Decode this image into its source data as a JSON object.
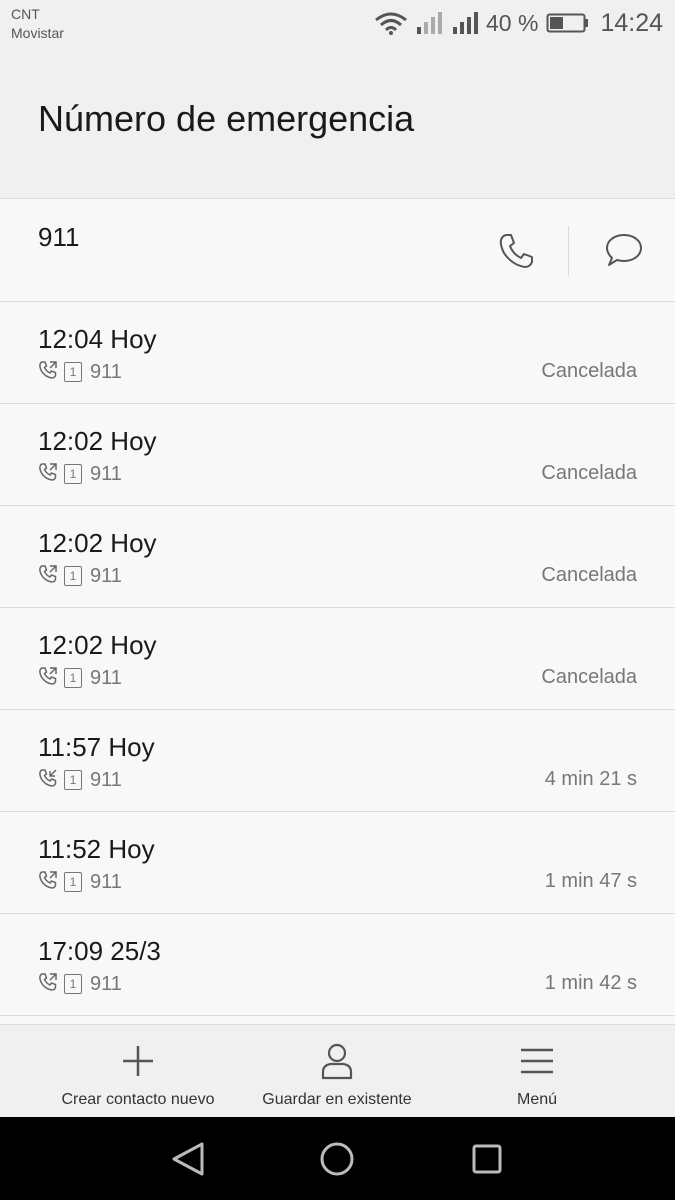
{
  "status_bar": {
    "carrier_line1": "CNT",
    "carrier_line2": "Movistar",
    "battery_percent": "40 %",
    "battery_level": 0.4,
    "time": "14:24"
  },
  "header": {
    "title": "Número de emergencia"
  },
  "number_row": {
    "number": "911",
    "call_icon": "phone-icon",
    "message_icon": "message-icon"
  },
  "call_log": [
    {
      "time": "12:04 Hoy",
      "type": "outgoing",
      "sim": "1",
      "number": "911",
      "status": "Cancelada"
    },
    {
      "time": "12:02 Hoy",
      "type": "outgoing",
      "sim": "1",
      "number": "911",
      "status": "Cancelada"
    },
    {
      "time": "12:02 Hoy",
      "type": "outgoing",
      "sim": "1",
      "number": "911",
      "status": "Cancelada"
    },
    {
      "time": "12:02 Hoy",
      "type": "outgoing",
      "sim": "1",
      "number": "911",
      "status": "Cancelada"
    },
    {
      "time": "11:57 Hoy",
      "type": "incoming",
      "sim": "1",
      "number": "911",
      "status": "4 min 21 s"
    },
    {
      "time": "11:52 Hoy",
      "type": "outgoing",
      "sim": "1",
      "number": "911",
      "status": "1 min 47 s"
    },
    {
      "time": "17:09 25/3",
      "type": "outgoing",
      "sim": "1",
      "number": "911",
      "status": "1 min 42 s"
    }
  ],
  "actions": {
    "new_contact": "Crear contacto nuevo",
    "save_existing": "Guardar en existente",
    "menu": "Menú"
  },
  "colors": {
    "background": "#f8f8f8",
    "header_bg": "#f0f0f0",
    "divider": "#dcdcdc",
    "secondary_text": "#777777",
    "nav_bar": "#000000"
  }
}
